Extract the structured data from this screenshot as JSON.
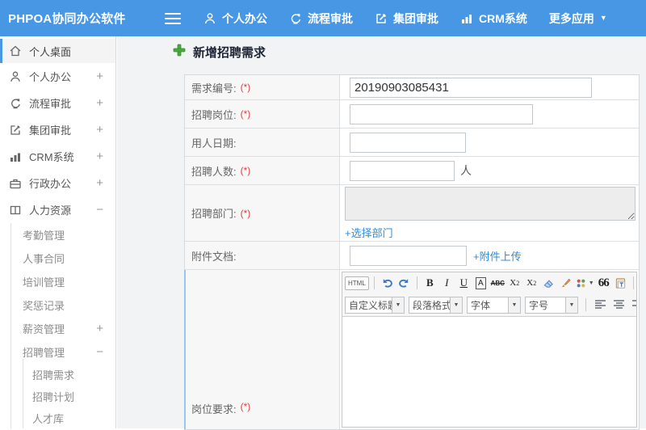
{
  "icons": {
    "caret_down": "▼"
  },
  "topbar": {
    "logo": "PHPOA协同办公软件",
    "nav": [
      {
        "label": "个人办公"
      },
      {
        "label": "流程审批"
      },
      {
        "label": "集团审批"
      },
      {
        "label": "CRM系统"
      },
      {
        "label": "更多应用"
      }
    ]
  },
  "sidebar": {
    "items": [
      {
        "label": "个人桌面"
      },
      {
        "label": "个人办公",
        "toggle": "+"
      },
      {
        "label": "流程审批",
        "toggle": "+"
      },
      {
        "label": "集团审批",
        "toggle": "+"
      },
      {
        "label": "CRM系统",
        "toggle": "+"
      },
      {
        "label": "行政办公",
        "toggle": "+"
      },
      {
        "label": "人力资源",
        "toggle": "−"
      }
    ],
    "hr_children": [
      {
        "label": "考勤管理"
      },
      {
        "label": "人事合同"
      },
      {
        "label": "培训管理"
      },
      {
        "label": "奖惩记录"
      },
      {
        "label": "薪资管理",
        "toggle": "+"
      },
      {
        "label": "招聘管理",
        "toggle": "−"
      }
    ],
    "recruit_children": [
      {
        "label": "招聘需求"
      },
      {
        "label": "招聘计划"
      },
      {
        "label": "人才库"
      }
    ]
  },
  "main": {
    "page_title": "新增招聘需求",
    "required_mark": "(*)",
    "form": {
      "rows": {
        "demand_no": {
          "label": "需求编号:",
          "value": "20190903085431"
        },
        "position": {
          "label": "招聘岗位:"
        },
        "hire_date": {
          "label": "用人日期:"
        },
        "headcount": {
          "label": "招聘人数:",
          "suffix": "人"
        },
        "department": {
          "label": "招聘部门:",
          "link": "+选择部门"
        },
        "attachment": {
          "label": "附件文档:",
          "link": "+附件上传"
        },
        "job_require": {
          "label": "岗位要求:"
        }
      }
    },
    "editor": {
      "html_button": "HTML",
      "bold": "B",
      "italic": "I",
      "underline": "U",
      "font_box": "A",
      "strikethrough": "ABC",
      "sup_base": "X",
      "sup_mark": "2",
      "sub_base": "X",
      "sub_mark": "2",
      "quote": "66",
      "font_color": "A",
      "bg_color": "ab",
      "dropdowns": [
        {
          "label": "自定义标题"
        },
        {
          "label": "段落格式"
        },
        {
          "label": "字体"
        },
        {
          "label": "字号"
        }
      ]
    }
  },
  "colors": {
    "topbar_blue": "#4797e4",
    "accent_green": "#4aa83c",
    "link_blue": "#2a8ce0",
    "required_red": "#e23b3b"
  }
}
